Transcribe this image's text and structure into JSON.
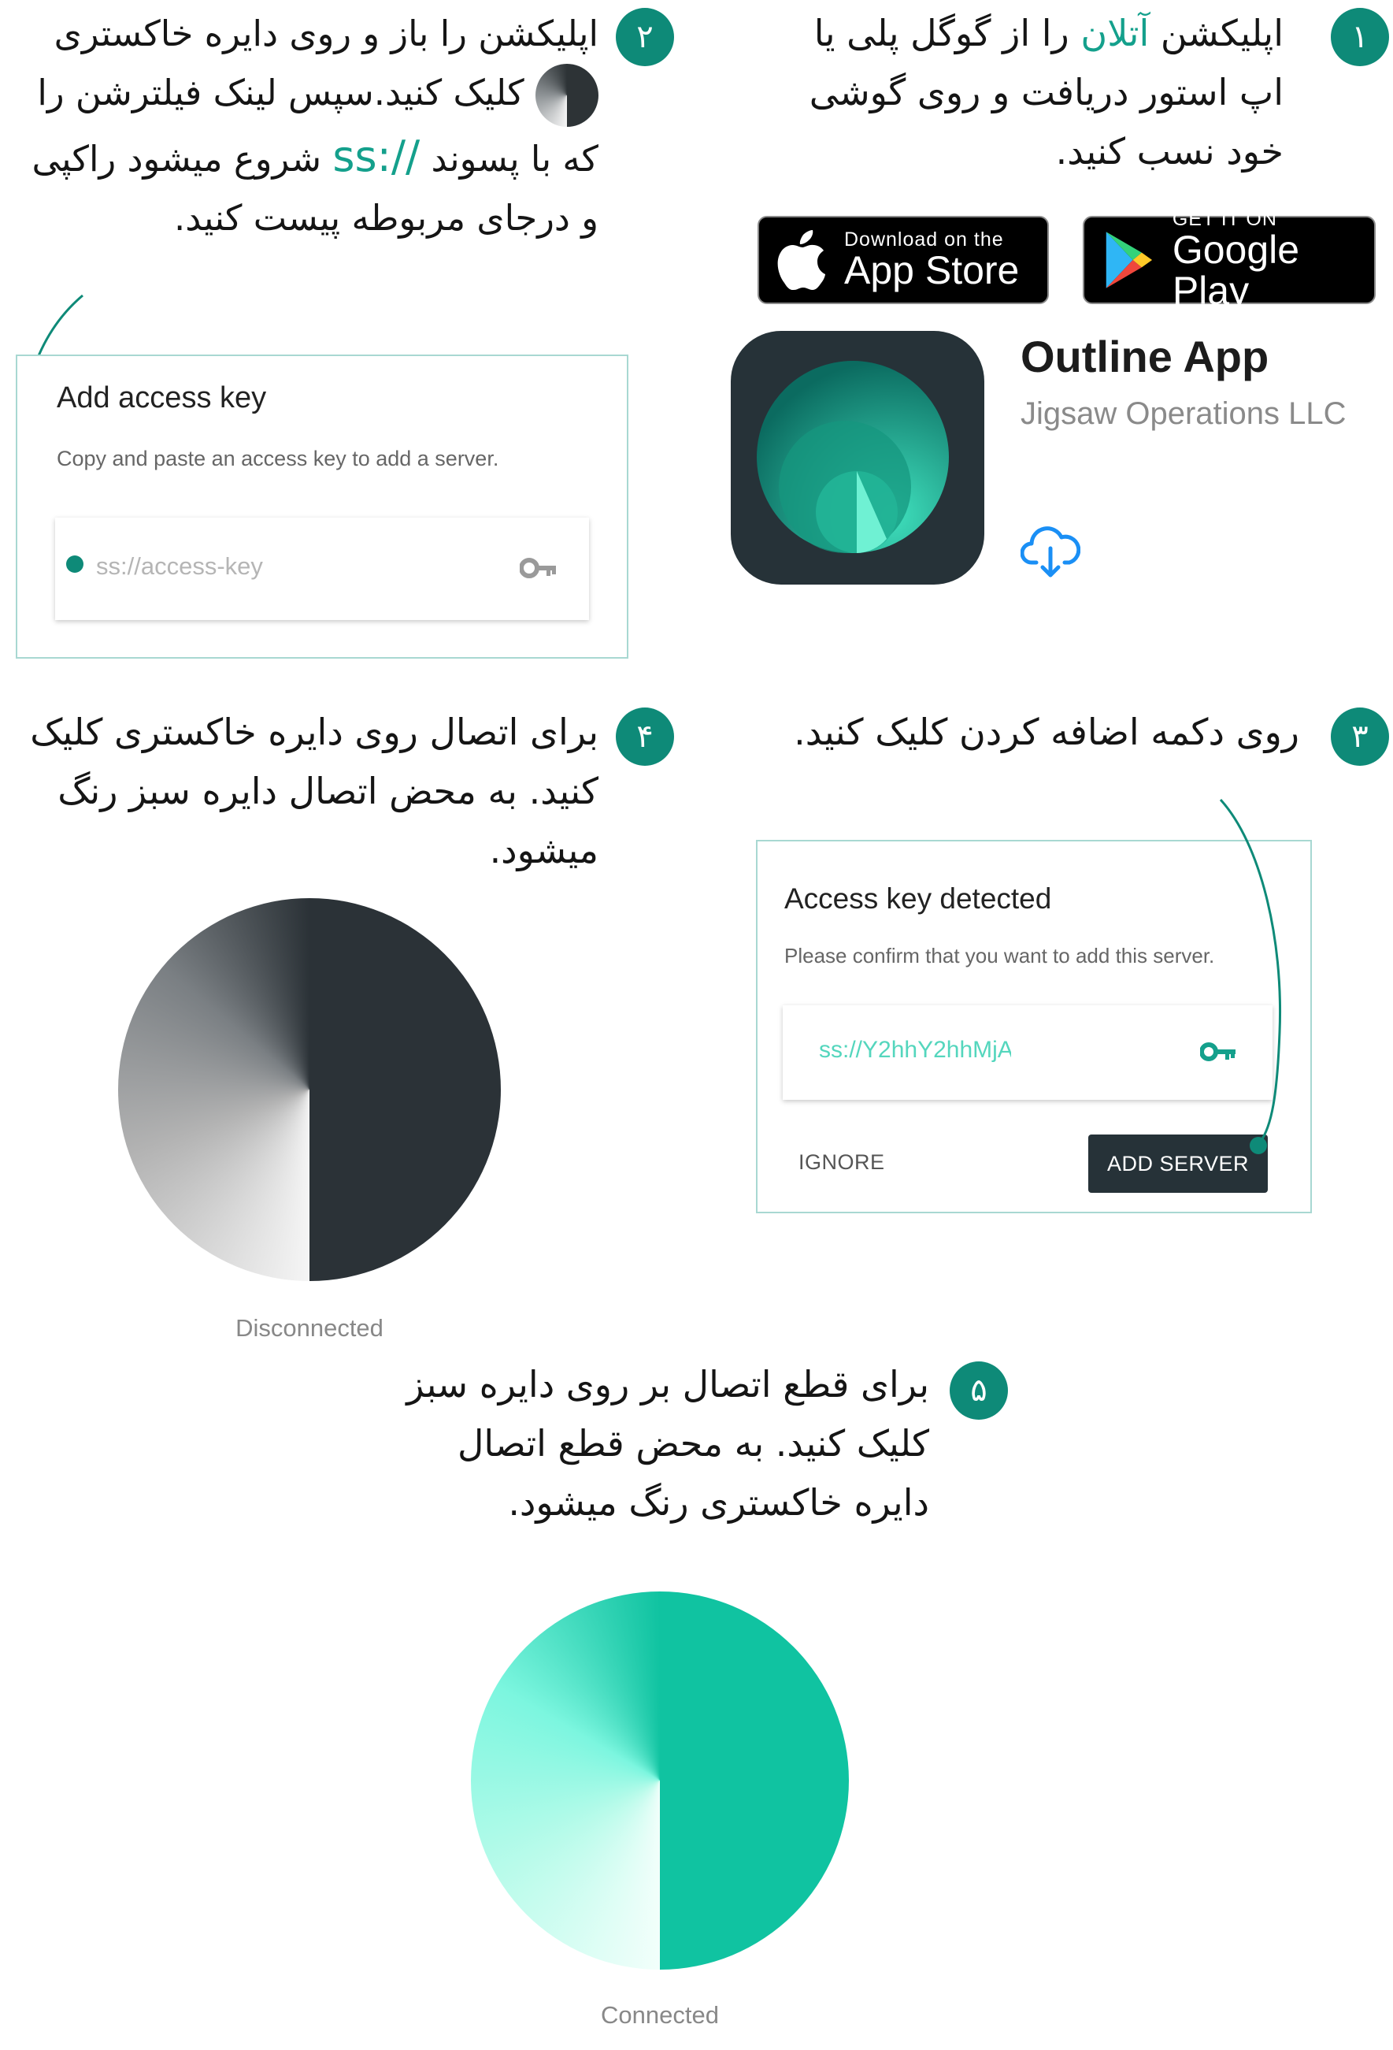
{
  "steps": {
    "s1": {
      "number": "۱",
      "text_before": "اپلیکشن ",
      "text_accent": "آتلان",
      "text_after": " را از گوگل پلی یا اپ استور دریافت و روی گوشی خود نسب کنید."
    },
    "s2": {
      "number": "۲",
      "text_a": "اپلیکشن را باز و روی دایره خاکستری",
      "text_b": "کلیک کنید.سپس لینک فیلترشن را که با پسوند",
      "ss_prefix": "ss://",
      "text_c": "شروع میشود راکپی و درجای مربوطه پیست کنید."
    },
    "s3": {
      "number": "۳",
      "text": "روی دکمه اضافه کردن کلیک کنید."
    },
    "s4": {
      "number": "۴",
      "text": "برای اتصال روی دایره خاکستری کلیک کنید. به محض اتصال دایره سبز رنگ میشود."
    },
    "s5": {
      "number": "۵",
      "text": "برای قطع اتصال بر روی دایره سبز کلیک کنید. به محض قطع اتصال دایره خاکستری رنگ میشود."
    }
  },
  "stores": {
    "appstore": {
      "small": "Download on the",
      "big": "App Store",
      "icon": "apple-icon"
    },
    "googleplay": {
      "small": "GET IT ON",
      "big": "Google Play",
      "icon": "google-play-icon"
    }
  },
  "app_listing": {
    "name": "Outline App",
    "publisher": "Jigsaw Operations LLC",
    "download_icon": "cloud-download-icon"
  },
  "add_key_dialog": {
    "title": "Add access key",
    "subtitle": "Copy and paste an access key to add a server.",
    "placeholder": "ss://access-key",
    "key_icon": "key-icon"
  },
  "detected_dialog": {
    "title": "Access key detected",
    "subtitle": "Please confirm that you want to add this server.",
    "value": "ss://Y2hhY2hhMjA",
    "ignore_label": "IGNORE",
    "add_label": "ADD SERVER"
  },
  "status": {
    "disconnected": "Disconnected",
    "connected": "Connected"
  },
  "colors": {
    "accent": "#14a08c",
    "badge": "#0e8a78",
    "dark": "#263238",
    "connect_light": "#7af5de",
    "connect_dark": "#0fbf9f"
  }
}
